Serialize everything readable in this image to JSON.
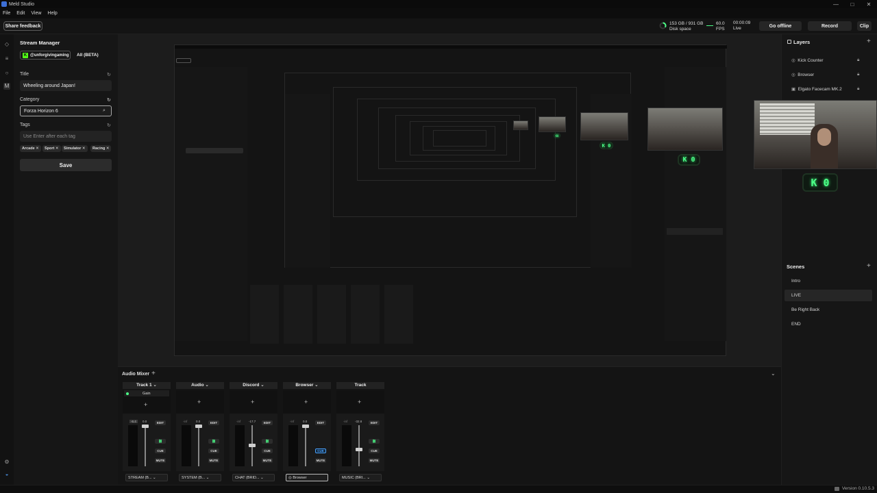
{
  "window": {
    "title": "Meld Studio"
  },
  "menu": [
    "File",
    "Edit",
    "View",
    "Help"
  ],
  "topbar": {
    "share_feedback": "Share feedback",
    "disk_value": "153 GB / 931 GB",
    "disk_label": "Disk space",
    "fps_value": "60.0",
    "fps_label": "FPS",
    "live_time": "00:00:09",
    "live_label": "Live",
    "go_offline": "Go offline",
    "record": "Record",
    "clip": "Clip"
  },
  "stream_manager": {
    "title": "Stream Manager",
    "account": "@unforgivingaming",
    "all_beta": "All (BETA)",
    "title_label": "Title",
    "title_value": "Wheeling around Japan!",
    "category_label": "Category",
    "category_value": "Forza Horizon 6",
    "tags_label": "Tags",
    "tags_placeholder": "Use Enter after each tag",
    "tags": [
      "Arcade",
      "Sport",
      "Simulator",
      "Racing"
    ],
    "save": "Save"
  },
  "layers": {
    "title": "Layers",
    "items": [
      "Kick Counter",
      "Browser",
      "Elgato Facecam MK.2"
    ]
  },
  "kick_counter": {
    "value": "0"
  },
  "scenes": {
    "title": "Scenes",
    "items": [
      "Intro",
      "LIVE",
      "Be Right Back",
      "END"
    ],
    "active": "LIVE"
  },
  "mixer": {
    "title": "Audio Mixer",
    "tracks": [
      {
        "name": "Track 1",
        "gain_label": "Gain",
        "db": "-6.4",
        "peak": "0.0",
        "source": "STREAM (B..."
      },
      {
        "name": "Audio",
        "db": "-inf",
        "peak": "0.0",
        "source": "SYSTEM (B..."
      },
      {
        "name": "Discord",
        "db": "-inf",
        "peak": "-17.7",
        "source": "CHAT (BRID..."
      },
      {
        "name": "Browser",
        "db": "-inf",
        "peak": "0.0",
        "source": "Browser"
      },
      {
        "name": "Track",
        "db": "-inf",
        "peak": "-32.8",
        "source": "MUSIC (BRI..."
      }
    ],
    "buttons": {
      "edit": "EDIT",
      "cue": "CUE",
      "mute": "MUTE"
    }
  },
  "status": {
    "version": "Version 0.10.5.3"
  },
  "colors": {
    "accent_green": "#4cff88",
    "kick_green": "#53fc18",
    "cue_blue": "#4aa3ff"
  }
}
